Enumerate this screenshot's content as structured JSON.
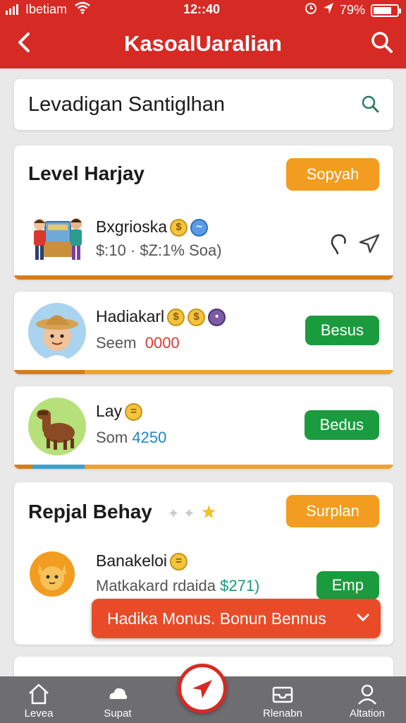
{
  "status_bar": {
    "carrier": "Ibetiam",
    "time": "12::40",
    "battery_text": "79%",
    "battery_level": 0.79
  },
  "header": {
    "title": "KasoalUaralian",
    "back_icon": "chevron-left-icon",
    "search_icon": "search-icon",
    "color": "#d62a24"
  },
  "search": {
    "placeholder": "Levadigan Santiglhan"
  },
  "sections": [
    {
      "title": "Level Harjay",
      "button": "Sopyah",
      "item": {
        "name": "Bxgrioska",
        "sub": "$:10 · $Z:1% Soa)"
      }
    },
    {
      "title": "Repjal Behay",
      "button": "Surplan",
      "item": {
        "name": "Banakeloi",
        "sub_left": "Matkakard rdaida",
        "sub_value": "$271)",
        "button": "Emp"
      }
    }
  ],
  "items": [
    {
      "name": "Hadiakarl",
      "sub_left": "Seem",
      "sub_value": "0000",
      "button": "Besus"
    },
    {
      "name": "Lay",
      "sub_left": "Som",
      "sub_value": "4250",
      "button": "Bedus"
    }
  ],
  "banner": {
    "text": "Hadika Monus. Bonun Bennus"
  },
  "tabbar": {
    "tabs": [
      {
        "label": "Levea",
        "icon": "home-icon"
      },
      {
        "label": "Supat",
        "icon": "cloud-icon"
      },
      {
        "label": "Rlenabn",
        "icon": "inbox-icon"
      },
      {
        "label": "Altation",
        "icon": "user-icon"
      }
    ],
    "center_icon": "send-icon"
  },
  "colors": {
    "orange": "#f29d1f",
    "green": "#1a9c3e",
    "red": "#d62a24",
    "banner": "#e94b28"
  }
}
